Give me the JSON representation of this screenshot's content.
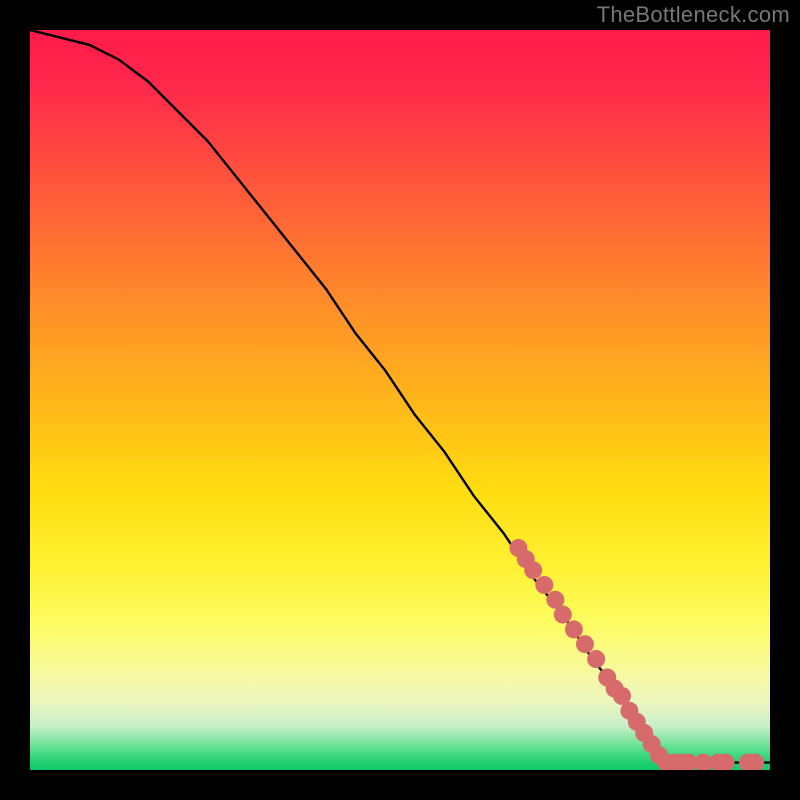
{
  "watermark": "TheBottleneck.com",
  "chart_data": {
    "type": "line",
    "xlabel": "",
    "ylabel": "",
    "xlim": [
      0,
      100
    ],
    "ylim": [
      0,
      100
    ],
    "title": "",
    "series": [
      {
        "name": "curve",
        "x": [
          0,
          4,
          8,
          12,
          16,
          20,
          24,
          28,
          32,
          36,
          40,
          44,
          48,
          52,
          56,
          60,
          64,
          68,
          72,
          76,
          80,
          84,
          85,
          88,
          92,
          96,
          100
        ],
        "y": [
          100,
          99,
          98,
          96,
          93,
          89,
          85,
          80,
          75,
          70,
          65,
          59,
          54,
          48,
          43,
          37,
          32,
          26,
          21,
          15,
          10,
          4,
          2,
          1,
          1,
          1,
          1
        ]
      }
    ],
    "markers": {
      "name": "highlight-points",
      "color": "#d76b6b",
      "radius": 9,
      "points": [
        {
          "x": 66,
          "y": 30
        },
        {
          "x": 67,
          "y": 28.5
        },
        {
          "x": 68,
          "y": 27
        },
        {
          "x": 69.5,
          "y": 25
        },
        {
          "x": 71,
          "y": 23
        },
        {
          "x": 72,
          "y": 21
        },
        {
          "x": 73.5,
          "y": 19
        },
        {
          "x": 75,
          "y": 17
        },
        {
          "x": 76.5,
          "y": 15
        },
        {
          "x": 78,
          "y": 12.5
        },
        {
          "x": 79,
          "y": 11
        },
        {
          "x": 80,
          "y": 10
        },
        {
          "x": 81,
          "y": 8
        },
        {
          "x": 82,
          "y": 6.5
        },
        {
          "x": 83,
          "y": 5
        },
        {
          "x": 84,
          "y": 3.5
        },
        {
          "x": 85,
          "y": 2
        },
        {
          "x": 86,
          "y": 1
        },
        {
          "x": 87,
          "y": 1
        },
        {
          "x": 88,
          "y": 1
        },
        {
          "x": 89,
          "y": 1
        },
        {
          "x": 91,
          "y": 1
        },
        {
          "x": 93,
          "y": 1
        },
        {
          "x": 94,
          "y": 1
        },
        {
          "x": 97,
          "y": 1
        },
        {
          "x": 98,
          "y": 1
        }
      ]
    }
  }
}
